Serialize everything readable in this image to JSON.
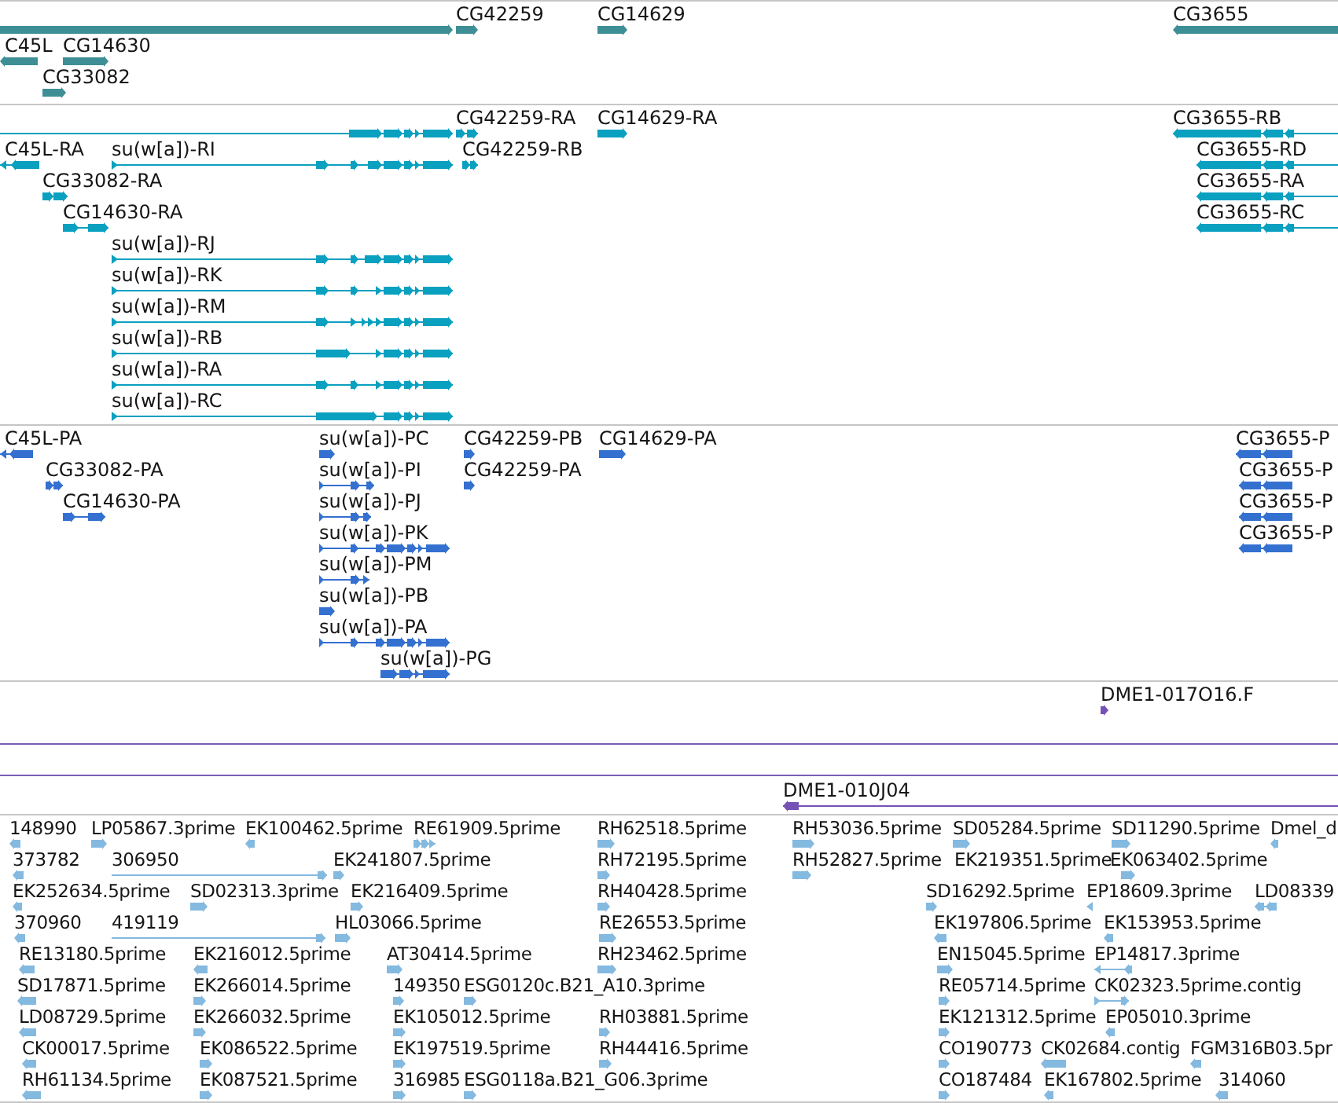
{
  "tracks": [
    {
      "kind": "gene",
      "features": [
        {
          "reverse": false
        },
        {
          "label": "CG42259",
          "reverse": false
        },
        {
          "label": "CG14629",
          "reverse": false
        },
        {
          "label": "CG3655",
          "reverse": true
        },
        {
          "label": "C45L",
          "reverse": true
        },
        {
          "label": "CG14630",
          "reverse": false
        },
        {
          "label": "CG33082",
          "reverse": false
        }
      ]
    },
    {
      "kind": "transcript",
      "features": [
        {
          "reverse": false
        },
        {
          "label": "CG42259-RA",
          "reverse": false
        },
        {
          "label": "CG14629-RA",
          "reverse": false
        },
        {
          "label": "CG3655-RB",
          "reverse": true
        },
        {
          "label": "C45L-RA",
          "reverse": true
        },
        {
          "label": "su(w[a])-RI",
          "reverse": false
        },
        {
          "label": "CG42259-RB",
          "reverse": false
        },
        {
          "label": "CG3655-RD",
          "reverse": true
        },
        {
          "label": "CG33082-RA",
          "reverse": false
        },
        {
          "label": "CG3655-RA",
          "reverse": true
        },
        {
          "label": "CG14630-RA",
          "reverse": false
        },
        {
          "label": "CG3655-RC",
          "reverse": true
        },
        {
          "label": "su(w[a])-RJ",
          "reverse": false
        },
        {
          "label": "su(w[a])-RK",
          "reverse": false
        },
        {
          "label": "su(w[a])-RM",
          "reverse": false
        },
        {
          "label": "su(w[a])-RB",
          "reverse": false
        },
        {
          "label": "su(w[a])-RA",
          "reverse": false
        },
        {
          "label": "su(w[a])-RC",
          "reverse": false
        }
      ]
    },
    {
      "kind": "polypeptide",
      "features": [
        {
          "label": "C45L-PA",
          "reverse": true
        },
        {
          "label": "su(w[a])-PC",
          "reverse": false
        },
        {
          "label": "CG42259-PB",
          "reverse": false
        },
        {
          "label": "CG14629-PA",
          "reverse": false
        },
        {
          "label": "CG3655-P",
          "reverse": true
        },
        {
          "label": "CG33082-PA",
          "reverse": false
        },
        {
          "label": "su(w[a])-PI",
          "reverse": false
        },
        {
          "label": "CG42259-PA",
          "reverse": false
        },
        {
          "label": "CG3655-P",
          "reverse": true
        },
        {
          "label": "CG14630-PA",
          "reverse": false
        },
        {
          "label": "su(w[a])-PJ",
          "reverse": false
        },
        {
          "label": "CG3655-P",
          "reverse": true
        },
        {
          "label": "su(w[a])-PK",
          "reverse": false
        },
        {
          "label": "CG3655-P",
          "reverse": true
        },
        {
          "label": "su(w[a])-PM",
          "reverse": false
        },
        {
          "label": "su(w[a])-PB",
          "reverse": false
        },
        {
          "label": "su(w[a])-PA",
          "reverse": false
        },
        {
          "label": "su(w[a])-PG",
          "reverse": false
        }
      ]
    },
    {
      "kind": "clone",
      "features": [
        {
          "label": "DME1-017O16.F",
          "reverse": false
        }
      ]
    },
    {
      "kind": "clone",
      "features": [
        {
          "label": "DME1-010J04",
          "reverse": true
        }
      ]
    },
    {
      "kind": "est",
      "features": [
        {
          "label": "148990",
          "reverse": true
        },
        {
          "label": "LP05867.3prime",
          "reverse": false
        },
        {
          "label": "EK100462.5prime",
          "reverse": true
        },
        {
          "label": "RE61909.5prime",
          "reverse": false
        },
        {
          "label": "RH62518.5prime",
          "reverse": false
        },
        {
          "label": "RH53036.5prime",
          "reverse": false
        },
        {
          "label": "SD05284.5prime",
          "reverse": false
        },
        {
          "label": "SD11290.5prime",
          "reverse": false
        },
        {
          "label": "Dmel_d",
          "reverse": true
        },
        {
          "label": "373782",
          "reverse": true
        },
        {
          "label": "306950",
          "reverse": false
        },
        {
          "label": "EK241807.5prime",
          "reverse": false
        },
        {
          "label": "RH72195.5prime",
          "reverse": false
        },
        {
          "label": "RH52827.5prime",
          "reverse": false
        },
        {
          "label": "EK219351.5prime"
        },
        {
          "label": "EK063402.5prime",
          "reverse": false
        },
        {
          "label": "EK252634.5prime",
          "reverse": true
        },
        {
          "label": "SD02313.3prime",
          "reverse": false
        },
        {
          "label": "EK216409.5prime",
          "reverse": false
        },
        {
          "label": "RH40428.5prime",
          "reverse": false
        },
        {
          "label": "SD16292.5prime",
          "reverse": false
        },
        {
          "label": "EP18609.3prime",
          "reverse": true
        },
        {
          "label": "LD08339",
          "reverse": true
        },
        {
          "label": "370960",
          "reverse": true
        },
        {
          "label": "419119",
          "reverse": false
        },
        {
          "label": "HL03066.5prime",
          "reverse": false
        },
        {
          "label": "RE26553.5prime",
          "reverse": false
        },
        {
          "label": "EK197806.5prime",
          "reverse": true
        },
        {
          "label": "EK153953.5prime",
          "reverse": true
        },
        {
          "label": "RE13180.5prime",
          "reverse": true
        },
        {
          "label": "EK216012.5prime",
          "reverse": true
        },
        {
          "label": "AT30414.5prime",
          "reverse": false
        },
        {
          "label": "RH23462.5prime",
          "reverse": false
        },
        {
          "label": "EN15045.5prime",
          "reverse": false
        },
        {
          "label": "EP14817.3prime",
          "reverse": true
        },
        {
          "label": "SD17871.5prime",
          "reverse": true
        },
        {
          "label": "EK266014.5prime",
          "reverse": false
        },
        {
          "label": "149350",
          "reverse": false
        },
        {
          "label": "ESG0120c.B21_A10.3prime",
          "reverse": false
        },
        {
          "label": "RE05714.5prime",
          "reverse": false
        },
        {
          "label": "CK02323.5prime.contig",
          "reverse": false
        },
        {
          "label": "LD08729.5prime",
          "reverse": true
        },
        {
          "label": "EK266032.5prime",
          "reverse": false
        },
        {
          "label": "EK105012.5prime",
          "reverse": false
        },
        {
          "label": "RH03881.5prime",
          "reverse": false
        },
        {
          "label": "EK121312.5prime",
          "reverse": false
        },
        {
          "label": "EP05010.3prime",
          "reverse": true
        },
        {
          "label": "CK00017.5prime",
          "reverse": true
        },
        {
          "label": "EK086522.5prime",
          "reverse": false
        },
        {
          "label": "EK197519.5prime",
          "reverse": false
        },
        {
          "label": "RH44416.5prime",
          "reverse": false
        },
        {
          "label": "CO190773",
          "reverse": false
        },
        {
          "label": "CK02684.contig",
          "reverse": true
        },
        {
          "label": "FGM316B03.5pr",
          "reverse": true
        },
        {
          "label": "RH61134.5prime",
          "reverse": true
        },
        {
          "label": "EK087521.5prime",
          "reverse": false
        },
        {
          "label": "316985",
          "reverse": false
        },
        {
          "label": "ESG0118a.B21_G06.3prime",
          "reverse": false
        },
        {
          "label": "CO187484",
          "reverse": false
        },
        {
          "label": "EK167802.5prime",
          "reverse": true
        },
        {
          "label": "314060",
          "reverse": true
        }
      ]
    }
  ]
}
